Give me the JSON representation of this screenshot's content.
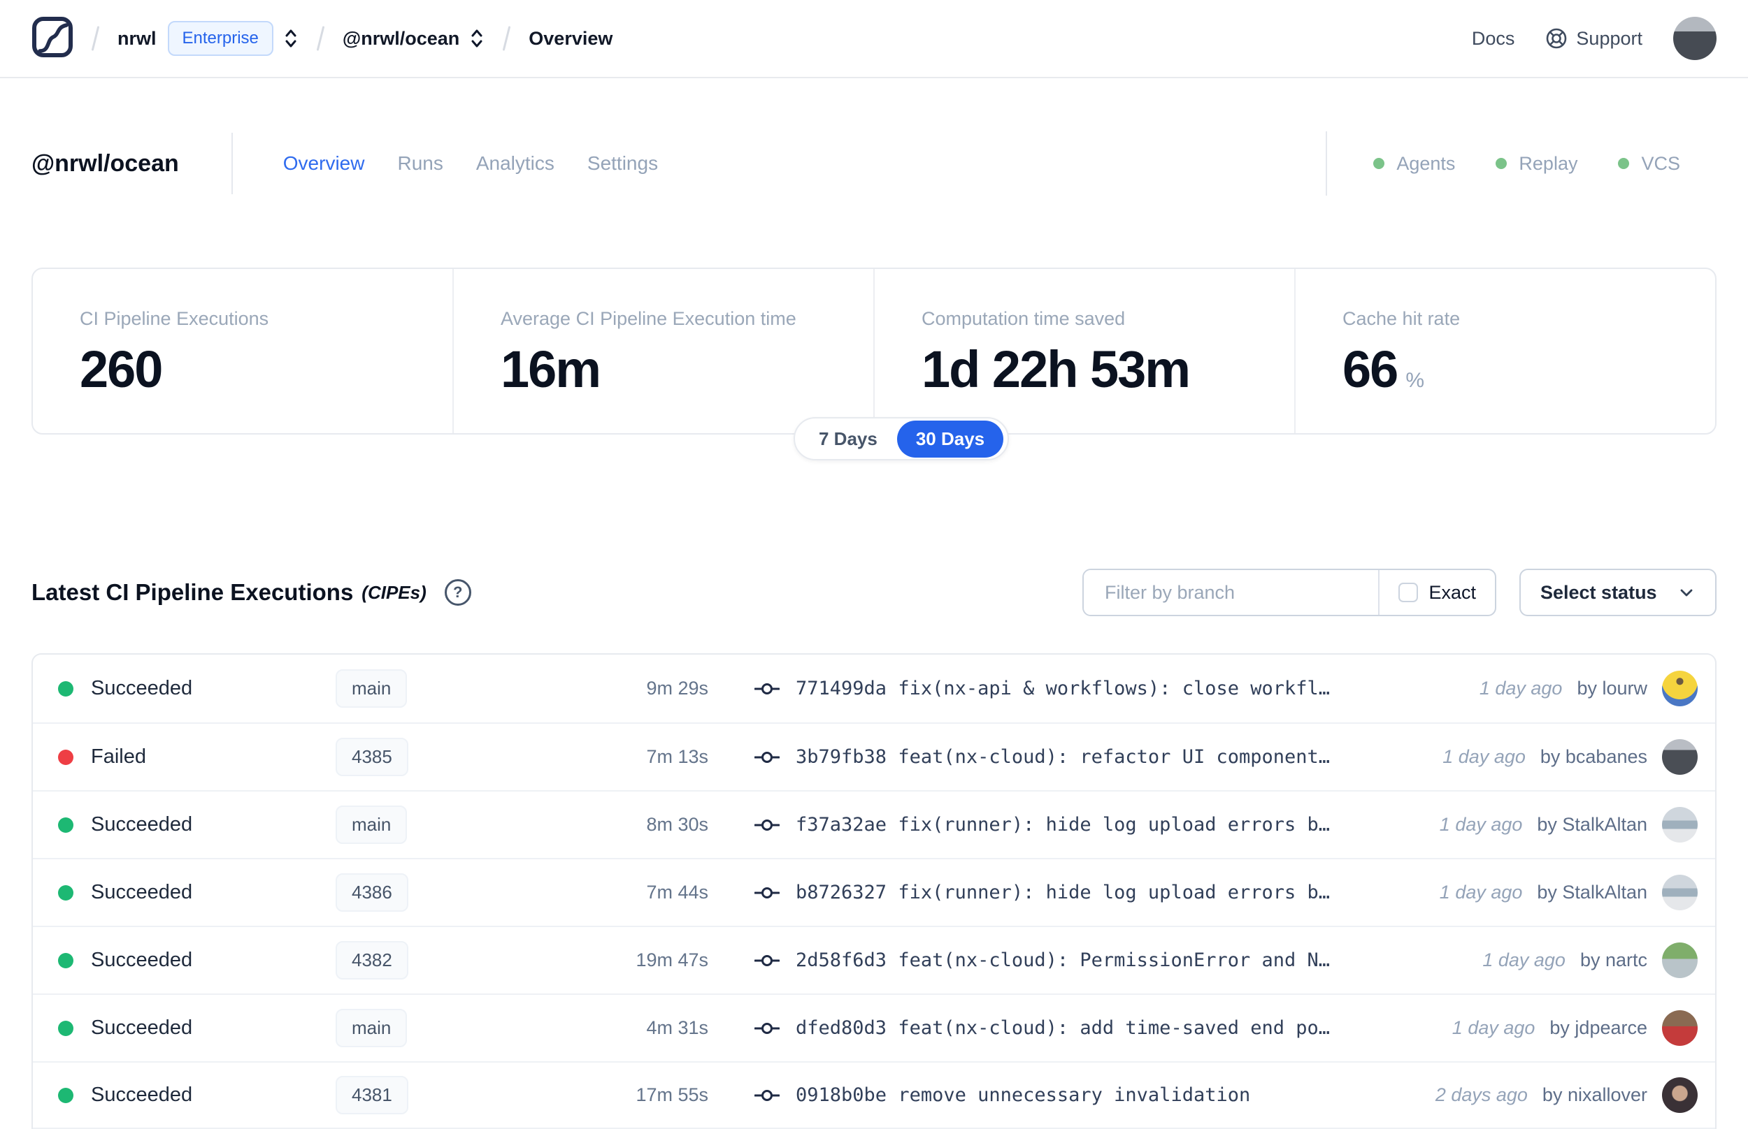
{
  "topbar": {
    "org": "nrwl",
    "plan_badge": "Enterprise",
    "workspace": "@nrwl/ocean",
    "page": "Overview",
    "docs_label": "Docs",
    "support_label": "Support"
  },
  "workspace_header": {
    "title": "@nrwl/ocean",
    "tabs": [
      {
        "label": "Overview",
        "active": true
      },
      {
        "label": "Runs",
        "active": false
      },
      {
        "label": "Analytics",
        "active": false
      },
      {
        "label": "Settings",
        "active": false
      }
    ],
    "statuses": [
      {
        "label": "Agents"
      },
      {
        "label": "Replay"
      },
      {
        "label": "VCS"
      }
    ]
  },
  "stats": {
    "cards": [
      {
        "label": "CI Pipeline Executions",
        "value": "260",
        "suffix": ""
      },
      {
        "label": "Average CI Pipeline Execution time",
        "value": "16m",
        "suffix": ""
      },
      {
        "label": "Computation time saved",
        "value": "1d 22h 53m",
        "suffix": ""
      },
      {
        "label": "Cache hit rate",
        "value": "66",
        "suffix": "%"
      }
    ],
    "range_toggle": {
      "options": [
        "7 Days",
        "30 Days"
      ],
      "selected": "30 Days"
    }
  },
  "cipe_section": {
    "title": "Latest CI Pipeline Executions",
    "title_suffix": "(CIPEs)",
    "help_glyph": "?",
    "filter": {
      "placeholder": "Filter by branch",
      "value": "",
      "exact_label": "Exact",
      "exact_checked": false
    },
    "status_select_label": "Select status"
  },
  "table": {
    "rows": [
      {
        "status": "Succeeded",
        "dot_style": "background:#1db873",
        "branch": "main",
        "duration": "9m 29s",
        "commit_hash": "771499da",
        "commit_message": "fix(nx-api & workflows): close workfl…",
        "time_ago": "1 day ago",
        "author": "by lourw"
      },
      {
        "status": "Failed",
        "dot_style": "background:#ee3e44",
        "branch": "4385",
        "duration": "7m 13s",
        "commit_hash": "3b79fb38",
        "commit_message": "feat(nx-cloud): refactor UI component…",
        "time_ago": "1 day ago",
        "author": "by bcabanes"
      },
      {
        "status": "Succeeded",
        "dot_style": "background:#1db873",
        "branch": "main",
        "duration": "8m 30s",
        "commit_hash": "f37a32ae",
        "commit_message": "fix(runner): hide log upload errors b…",
        "time_ago": "1 day ago",
        "author": "by StalkAltan"
      },
      {
        "status": "Succeeded",
        "dot_style": "background:#1db873",
        "branch": "4386",
        "duration": "7m 44s",
        "commit_hash": "b8726327",
        "commit_message": "fix(runner): hide log upload errors b…",
        "time_ago": "1 day ago",
        "author": "by StalkAltan"
      },
      {
        "status": "Succeeded",
        "dot_style": "background:#1db873",
        "branch": "4382",
        "duration": "19m 47s",
        "commit_hash": "2d58f6d3",
        "commit_message": "feat(nx-cloud): PermissionError and N…",
        "time_ago": "1 day ago",
        "author": "by nartc"
      },
      {
        "status": "Succeeded",
        "dot_style": "background:#1db873",
        "branch": "main",
        "duration": "4m 31s",
        "commit_hash": "dfed80d3",
        "commit_message": "feat(nx-cloud): add time-saved end po…",
        "time_ago": "1 day ago",
        "author": "by jdpearce"
      },
      {
        "status": "Succeeded",
        "dot_style": "background:#1db873",
        "branch": "4381",
        "duration": "17m 55s",
        "commit_hash": "0918b0be",
        "commit_message": "remove unnecessary invalidation",
        "time_ago": "2 days ago",
        "author": "by nixallover"
      }
    ]
  },
  "colors": {
    "accent_blue": "#2563eb",
    "success_green": "#1db873",
    "failed_red": "#ee3e44",
    "header_status_green": "#7bc389"
  }
}
